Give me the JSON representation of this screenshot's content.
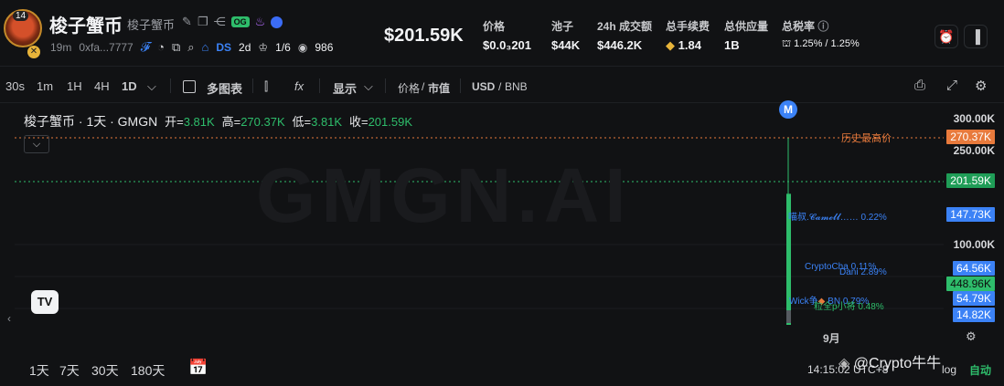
{
  "header": {
    "avatar_badge": "14",
    "token_name": "梭子蟹币",
    "token_name_sub": "梭子蟹币",
    "tag_og": "OG",
    "age": "19m",
    "address": "0xfa...7777",
    "ds_label": "DS",
    "ds_age": "2d",
    "crown_count": "1/6",
    "views": "986",
    "price": "$201.59K",
    "stats": [
      {
        "label": "价格",
        "value": "$0.0₃201"
      },
      {
        "label": "池子",
        "value": "$44K"
      },
      {
        "label": "24h 成交额",
        "value": "$446.2K"
      },
      {
        "label": "总手续费",
        "value": "1.84"
      },
      {
        "label": "总供应量",
        "value": "1B"
      },
      {
        "label": "总税率",
        "value": "1.25% / 1.25%"
      }
    ]
  },
  "toolbar": {
    "intervals": [
      "30s",
      "1m",
      "1H",
      "4H",
      "1D"
    ],
    "multi_chart": "多图表",
    "display": "显示",
    "price_label": "价格",
    "mcap_label": "市值",
    "usd_label": "USD",
    "bnb_label": "BNB"
  },
  "chart": {
    "title": "梭子蟹币 · 1天 · GMGN",
    "open_label": "开=",
    "open_value": "3.81K",
    "high_label": "高=",
    "high_value": "270.37K",
    "low_label": "低=",
    "low_value": "3.81K",
    "close_label": "收=",
    "close_value": "201.59K",
    "watermark": "GMGN.AI",
    "marker": "M",
    "ath_label": "历史最高价",
    "date_label": "9月",
    "axis_ticks": [
      "300.00K",
      "250.00K",
      "100.00K"
    ],
    "price_tags": {
      "ath": "270.37K",
      "current": "201.59K",
      "t1": "147.73K",
      "t2": "64.56K",
      "t3": "448.96K",
      "t4": "54.79K",
      "t5": "14.82K"
    },
    "holders": [
      {
        "name": "喵叔.𝓒𝓪𝓶𝓮𝓵𝓵",
        "pct": "0.22%"
      },
      {
        "name": "CryptoCha",
        "pct": "0.11%"
      },
      {
        "name": "Dani",
        "pct": "2.89%"
      },
      {
        "name": "Wick争",
        "pct": "BN    0.79%"
      },
      {
        "name": "粒全p小将",
        "pct": "0.48%"
      }
    ],
    "candle": {
      "open": 3.81,
      "high": 270.37,
      "low": 3.81,
      "close": 201.59
    }
  },
  "bottom": {
    "ranges": [
      "1天",
      "7天",
      "30天",
      "180天"
    ],
    "time": "14:15:02 UTC+8",
    "watermark_text": "@Crypto牛牛",
    "log": "log",
    "auto": "自动"
  },
  "colors": {
    "green": "#2ebd6b",
    "orange": "#e87a3c",
    "blue": "#3b82f6",
    "bg": "#111214"
  }
}
